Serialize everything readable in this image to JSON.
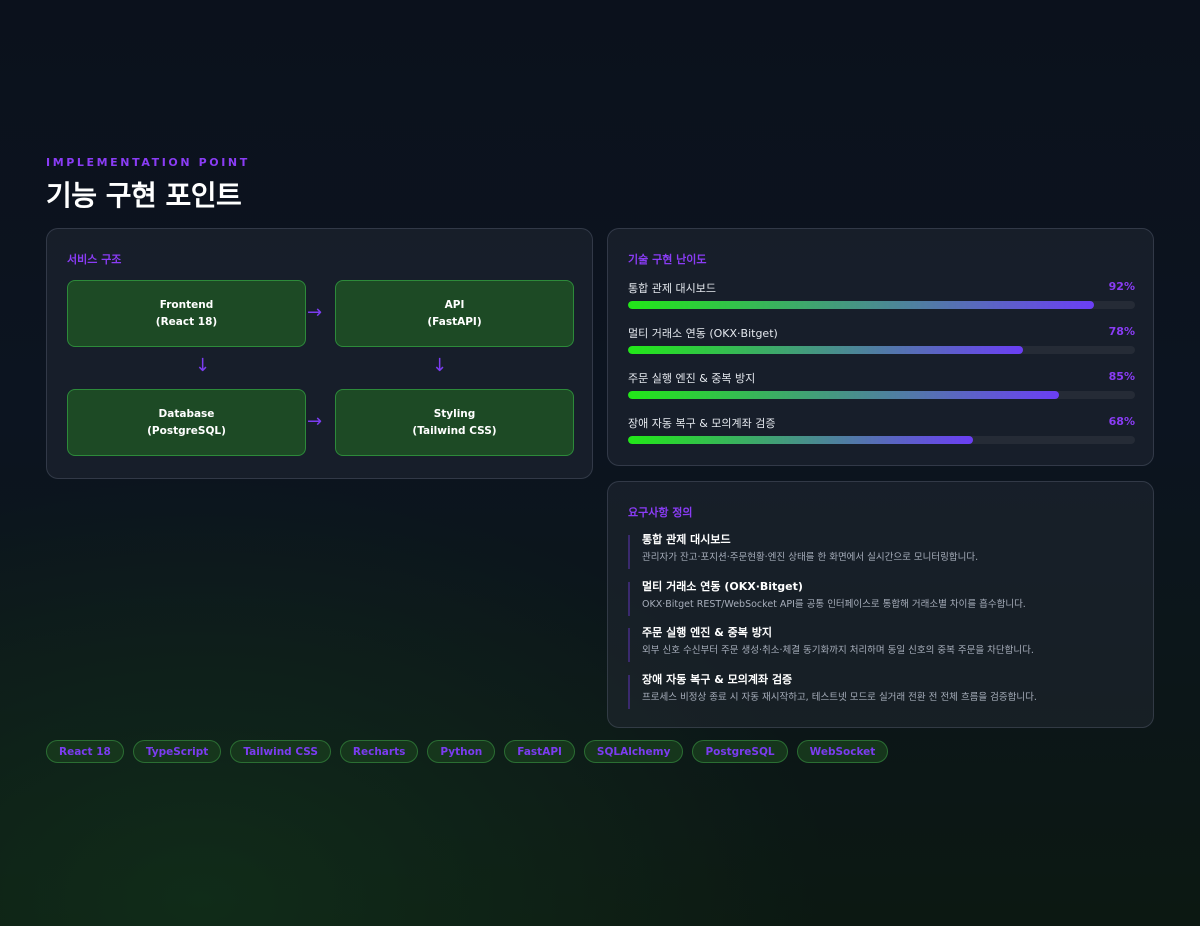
{
  "header": {
    "eyebrow": "IMPLEMENTATION POINT",
    "title": "기능 구현 포인트"
  },
  "architecture": {
    "title": "서비스 구조",
    "nodes": [
      {
        "name": "Frontend",
        "detail": "(React 18)"
      },
      {
        "name": "API",
        "detail": "(FastAPI)"
      },
      {
        "name": "Database",
        "detail": "(PostgreSQL)"
      },
      {
        "name": "Styling",
        "detail": "(Tailwind CSS)"
      }
    ],
    "arrows": {
      "right": "→",
      "down": "↓"
    }
  },
  "difficulty": {
    "title": "기술 구현 난이도",
    "items": [
      {
        "label": "통합 관제 대시보드",
        "pct_text": "92%",
        "value": 92
      },
      {
        "label": "멀티 거래소 연동 (OKX·Bitget)",
        "pct_text": "78%",
        "value": 78
      },
      {
        "label": "주문 실행 엔진 & 중복 방지",
        "pct_text": "85%",
        "value": 85
      },
      {
        "label": "장애 자동 복구 & 모의계좌 검증",
        "pct_text": "68%",
        "value": 68
      }
    ]
  },
  "requirements": {
    "title": "요구사항 정의",
    "items": [
      {
        "title": "통합 관제 대시보드",
        "desc": "관리자가 잔고·포지션·주문현황·엔진 상태를 한 화면에서 실시간으로 모니터링합니다."
      },
      {
        "title": "멀티 거래소 연동 (OKX·Bitget)",
        "desc": "OKX·Bitget REST/WebSocket API를 공통 인터페이스로 통합해 거래소별 차이를 흡수합니다."
      },
      {
        "title": "주문 실행 엔진 & 중복 방지",
        "desc": "외부 신호 수신부터 주문 생성·취소·체결 동기화까지 처리하며 동일 신호의 중복 주문을 차단합니다."
      },
      {
        "title": "장애 자동 복구 & 모의계좌 검증",
        "desc": "프로세스 비정상 종료 시 자동 재시작하고, 테스트넷 모드로 실거래 전환 전 전체 흐름을 검증합니다."
      }
    ]
  },
  "tags": [
    "React 18",
    "TypeScript",
    "Tailwind CSS",
    "Recharts",
    "Python",
    "FastAPI",
    "SQLAlchemy",
    "PostgreSQL",
    "WebSocket"
  ],
  "colors": {
    "accent": "#8a3cf5",
    "node_bg": "#1d4a25",
    "bar_start": "#22e818",
    "bar_end": "#6b3ef5"
  }
}
